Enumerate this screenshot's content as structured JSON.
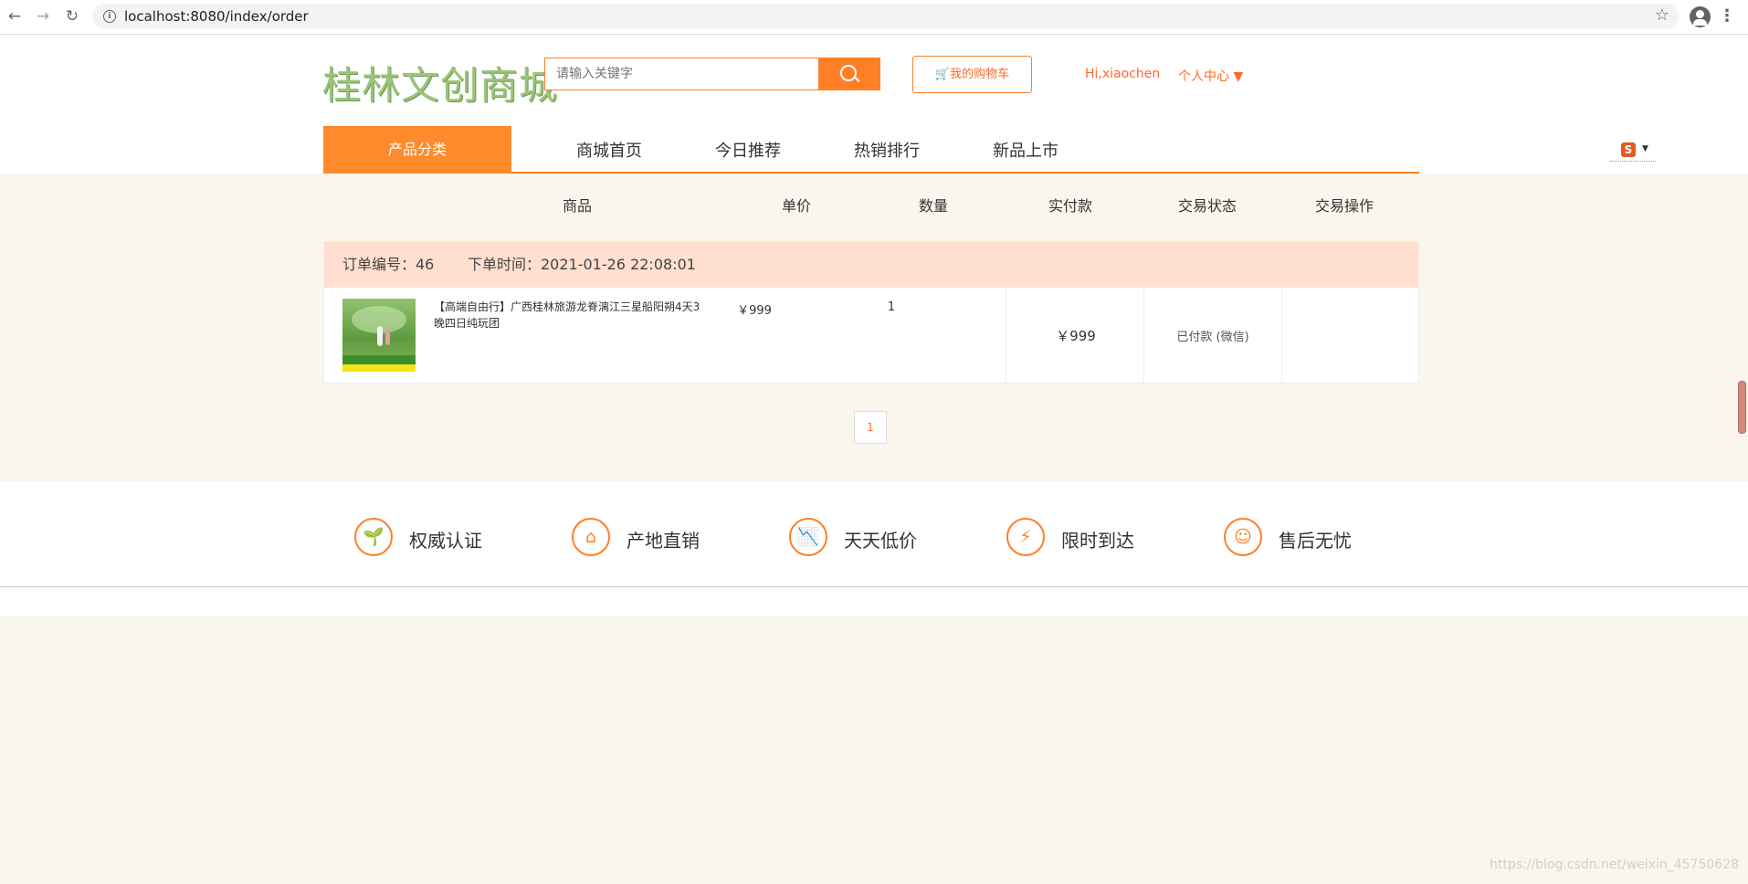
{
  "browser": {
    "url": "localhost:8080/index/order",
    "back_icon": "←",
    "forward_icon": "→",
    "reload_icon": "↻",
    "star_icon": "☆",
    "menu_icon": "⋮"
  },
  "header": {
    "logo": "桂林文创商城",
    "search_placeholder": "请输入关键字",
    "cart_label": "🛒我的购物车",
    "greeting": "Hi,xiaochen",
    "user_center": "个人中心 ▼"
  },
  "nav": {
    "category": "产品分类",
    "links": [
      "商城首页",
      "今日推荐",
      "热销排行",
      "新品上市"
    ]
  },
  "table": {
    "headers": [
      "商品",
      "单价",
      "数量",
      "实付款",
      "交易状态",
      "交易操作"
    ]
  },
  "order": {
    "number_label": "订单编号：46",
    "time_label": "下单时间：2021-01-26 22:08:01",
    "product_name": "【高端自由行】广西桂林旅游龙脊漓江三星船阳朔4天3晚四日纯玩团",
    "unit_price": "￥999",
    "quantity": "1",
    "paid": "￥999",
    "status": "已付款 (微信)"
  },
  "pagination": {
    "current": "1"
  },
  "features": [
    {
      "icon": "🌱",
      "label": "权威认证"
    },
    {
      "icon": "⌂",
      "label": "产地直销"
    },
    {
      "icon": "📉",
      "label": "天天低价"
    },
    {
      "icon": "⚡",
      "label": "限时到达"
    },
    {
      "icon": "☺",
      "label": "售后无忧"
    }
  ],
  "watermark": "https://blog.csdn.net/weixin_45750628",
  "colors": {
    "accent": "#ff7f27",
    "order_header": "#ffdfcf",
    "page_bg": "#faf6ee",
    "logo_green": "#9bc47a"
  }
}
